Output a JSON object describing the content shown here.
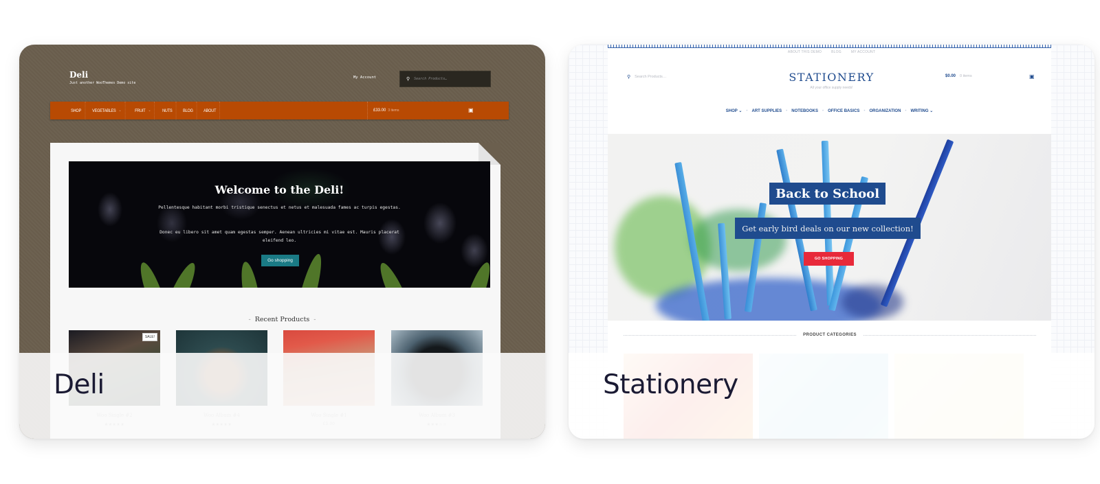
{
  "cards": [
    {
      "title": "Deli",
      "preview": {
        "site_title": "Deli",
        "tagline": "Just another WooThemes Demo site",
        "account_link": "My Account",
        "search_placeholder": "Search Products…",
        "nav": [
          {
            "label": "SHOP",
            "has_dropdown": false
          },
          {
            "label": "VEGETABLES",
            "has_dropdown": true
          },
          {
            "label": "FRUIT",
            "has_dropdown": true
          },
          {
            "label": "NUTS",
            "has_dropdown": false
          },
          {
            "label": "BLOG",
            "has_dropdown": false
          },
          {
            "label": "ABOUT",
            "has_dropdown": false
          }
        ],
        "cart_amount": "£33.00",
        "cart_count": "3 items",
        "hero": {
          "title": "Welcome to the Deli!",
          "paragraph_1": "Pellentesque habitant morbi tristique senectus et netus et malesuada fames ac turpis egestas.",
          "paragraph_2": "Donec eu libero sit amet quam egestas semper. Aenean ultricies mi vitae est. Mauris placerat eleifend leo.",
          "button": "Go shopping"
        },
        "recent_heading": "Recent Products",
        "products": [
          {
            "title": "Woo Single #2",
            "badge": "SALE!",
            "meta": "★★★★★"
          },
          {
            "title": "Woo Album #4",
            "badge": "",
            "meta": "★★★★★"
          },
          {
            "title": "Woo Single #1",
            "badge": "",
            "meta": "£3.00"
          },
          {
            "title": "Woo Album #3",
            "badge": "",
            "meta": "★★★☆☆"
          }
        ],
        "colors": {
          "background": "#6b5f4e",
          "nav": "#b84a03",
          "button": "#1a7a85"
        }
      }
    },
    {
      "title": "Stationery",
      "preview": {
        "top_links": [
          "ABOUT THIS DEMO",
          "BLOG",
          "MY ACCOUNT"
        ],
        "search_placeholder": "Search Products…",
        "site_title": "STATIONERY",
        "tagline": "All your office supply needs!",
        "cart_amount": "$0.00",
        "cart_count": "0 items",
        "nav": [
          {
            "label": "SHOP",
            "has_dropdown": true
          },
          {
            "label": "ART SUPPLIES",
            "has_dropdown": false
          },
          {
            "label": "NOTEBOOKS",
            "has_dropdown": false
          },
          {
            "label": "OFFICE BASICS",
            "has_dropdown": false
          },
          {
            "label": "ORGANIZATION",
            "has_dropdown": false
          },
          {
            "label": "WRITING",
            "has_dropdown": true
          }
        ],
        "hero": {
          "title": "Back to School",
          "subtitle": "Get early bird deals on our new collection!",
          "button": "GO SHOPPING"
        },
        "categories_heading": "PRODUCT CATEGORIES",
        "colors": {
          "brand": "#1f4b8e",
          "button": "#e8293a"
        }
      }
    }
  ],
  "icons": {
    "search": "⚲",
    "cart": "🛒",
    "chevron": "⌄"
  }
}
